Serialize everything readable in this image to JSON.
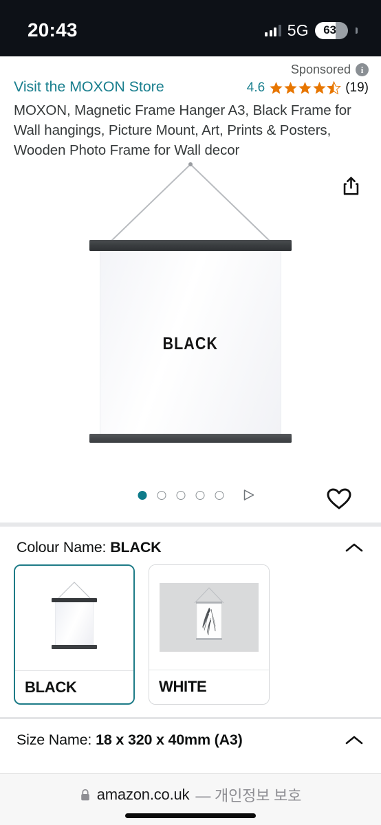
{
  "status_bar": {
    "time": "20:43",
    "network": "5G",
    "battery_percent": "63",
    "signal_icon": "signal-bars-icon",
    "battery_icon": "battery-icon"
  },
  "ad": {
    "sponsored_label": "Sponsored",
    "info_icon": "info-icon",
    "info_glyph": "i"
  },
  "product": {
    "store_link": "Visit the MOXON Store",
    "rating_value": "4.6",
    "rating_stars": 4.5,
    "rating_count": "(19)",
    "title": "MOXON, Magnetic Frame Hanger A3, Black Frame for Wall hangings, Picture Mount, Art, Prints & Posters, Wooden Photo Frame for Wall decor",
    "hero_poster_text": "BLACK",
    "share_icon": "share-icon",
    "favorite_icon": "heart-icon"
  },
  "carousel": {
    "total_dots": 5,
    "active_index": 0,
    "video_icon": "play-triangle-icon"
  },
  "colour_section": {
    "label": "Colour Name:",
    "selected_value": "BLACK",
    "collapse_icon": "chevron-up-icon",
    "options": [
      {
        "name": "BLACK",
        "selected": true,
        "swatch_icon": "black-frame-thumbnail"
      },
      {
        "name": "WHITE",
        "selected": false,
        "swatch_icon": "white-frame-feather-thumbnail"
      }
    ]
  },
  "size_section": {
    "label": "Size Name:",
    "selected_value": "18 x 320 x 40mm (A3)",
    "collapse_icon": "chevron-up-icon"
  },
  "browser_bar": {
    "lock_icon": "lock-icon",
    "domain": "amazon.co.uk",
    "privacy_note": "— 개인정보 보호"
  },
  "colors": {
    "accent_teal": "#1a7f8e",
    "star_orange": "#e77600",
    "status_bar_bg": "#0d1117",
    "selected_border": "#1d7b87"
  }
}
